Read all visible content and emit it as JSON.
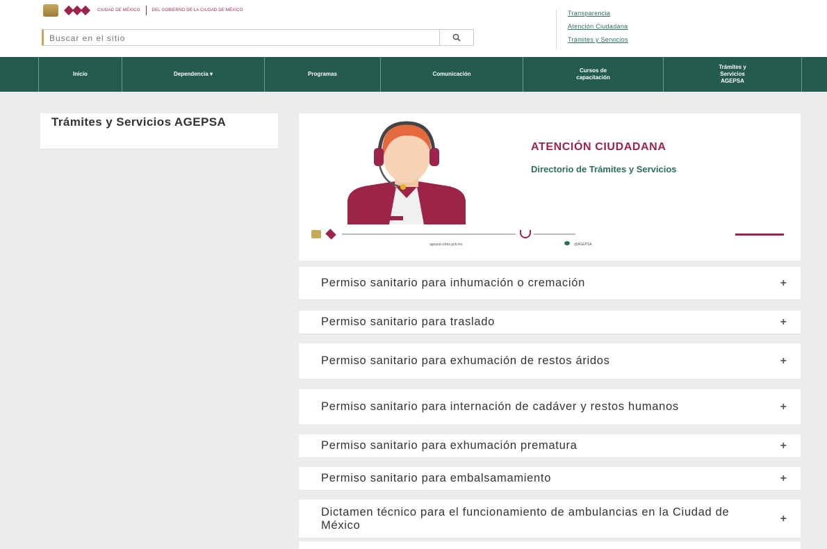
{
  "header": {
    "logo_text_a": "CIUDAD DE MÉXICO",
    "logo_text_b": "DEL GOBIERNO DE LA CIUDAD DE MÉXICO",
    "search_placeholder": "Buscar en el sitio",
    "top_links": [
      "Transparencia",
      "Atención Ciudadana",
      "Trámites y Servicios"
    ]
  },
  "nav": {
    "items": [
      {
        "label": "Inicio"
      },
      {
        "label": "Dependencia ▾"
      },
      {
        "label": "Programas"
      },
      {
        "label": "Comunicación"
      },
      {
        "label": "Cursos de capacitación"
      },
      {
        "label": "Trámites y Servicios AGEPSA"
      }
    ]
  },
  "sidebar": {
    "title": "Trámites y Servicios AGEPSA"
  },
  "banner": {
    "title": "ATENCIÓN CIUDADANA",
    "subtitle": "Directorio de Trámites y Servicios",
    "badge": "AGEPSA",
    "footer_web": "agepsa.cdmx.gob.mx",
    "footer_social": "@AGEPSA"
  },
  "accordion": [
    {
      "title": "Permiso sanitario para inhumación o cremación"
    },
    {
      "title": "Permiso sanitario para traslado"
    },
    {
      "title": "Permiso sanitario para exhumación de restos áridos"
    },
    {
      "title": "Permiso sanitario para internación de cadáver y restos humanos"
    },
    {
      "title": "Permiso sanitario para exhumación prematura"
    },
    {
      "title": "Permiso sanitario para embalsamamiento"
    },
    {
      "title": "Dictamen técnico para el funcionamiento de ambulancias en la Ciudad de México"
    }
  ],
  "icons": {
    "search": "search-icon",
    "expand": "plus-icon"
  },
  "colors": {
    "nav_bg": "#235b4e",
    "accent_red": "#9d2449",
    "accent_green": "#2b6f5a",
    "gold": "#c8a85a"
  }
}
